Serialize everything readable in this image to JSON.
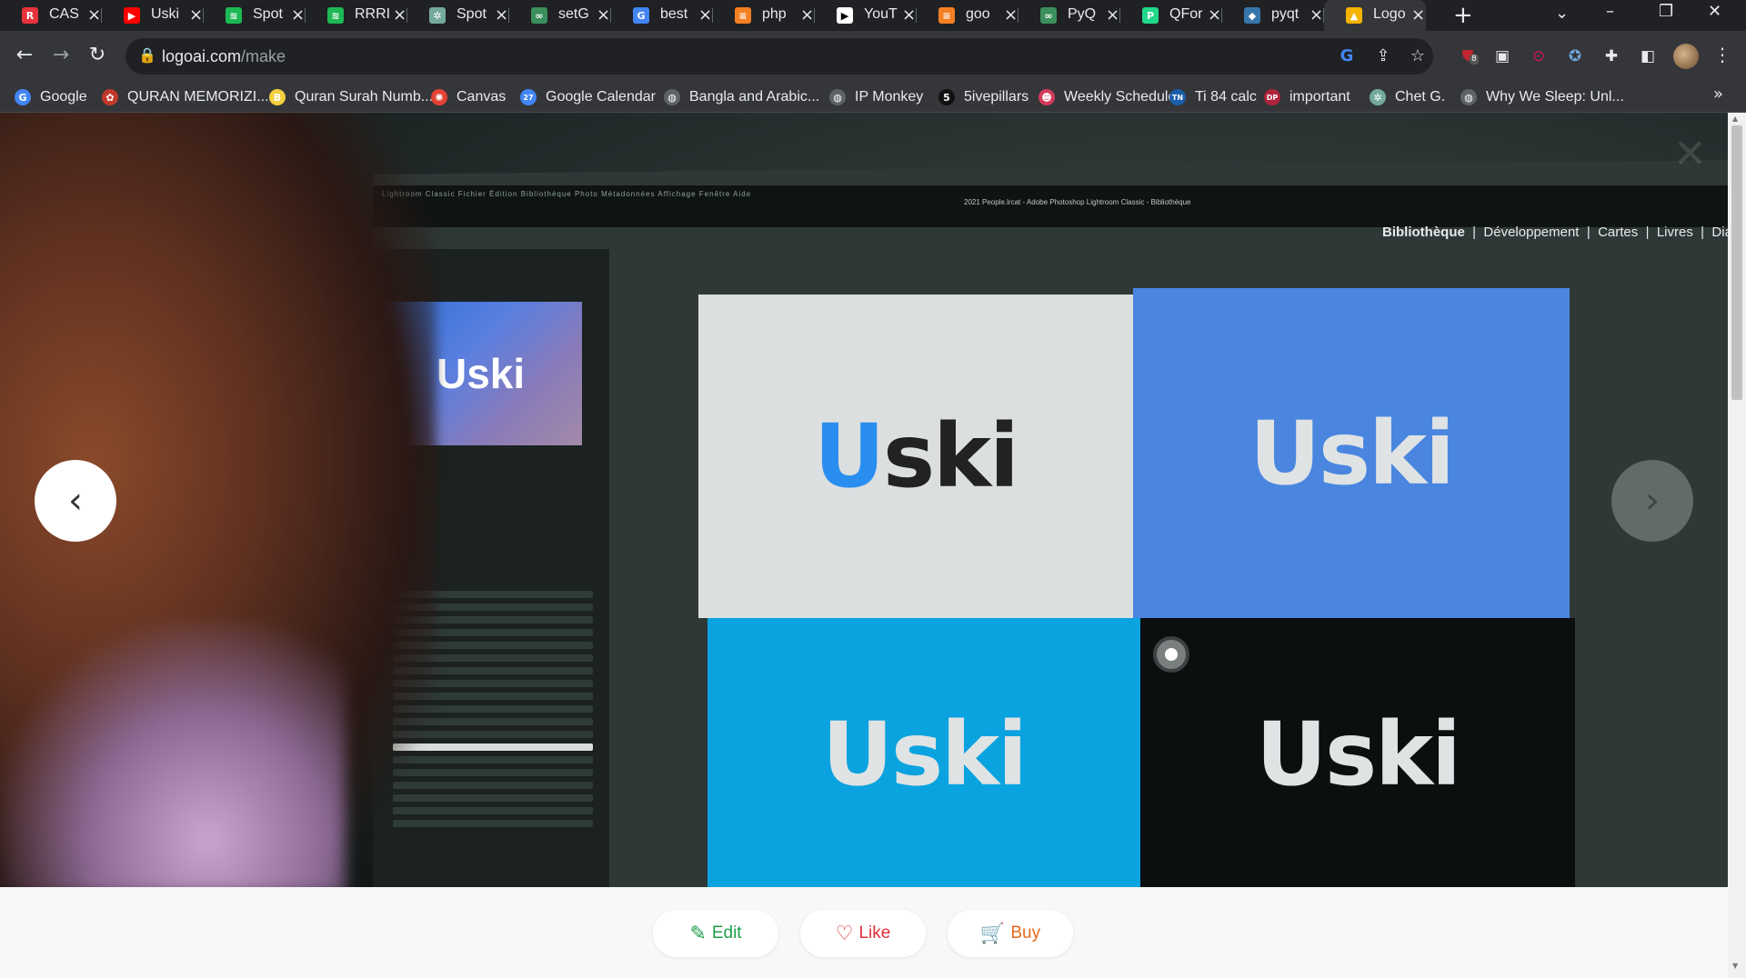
{
  "tabs": [
    {
      "title": "CAS",
      "icon": "cas-icon",
      "color": "#e8333a",
      "glyph": "R"
    },
    {
      "title": "Uski",
      "icon": "youtube-icon",
      "color": "#ff0000",
      "glyph": "▶"
    },
    {
      "title": "Spot",
      "icon": "spotify-icon",
      "color": "#1db954",
      "glyph": "≋"
    },
    {
      "title": "RRRI",
      "icon": "spotify-icon",
      "color": "#1db954",
      "glyph": "≋"
    },
    {
      "title": "Spot",
      "icon": "chatgpt-icon",
      "color": "#74aa9c",
      "glyph": "✲"
    },
    {
      "title": "setG",
      "icon": "link-icon",
      "color": "#3a8f5c",
      "glyph": "∞"
    },
    {
      "title": "best",
      "icon": "google-icon",
      "color": "#4285f4",
      "glyph": "G"
    },
    {
      "title": "php",
      "icon": "stackoverflow-icon",
      "color": "#f48024",
      "glyph": "≡"
    },
    {
      "title": "YouT",
      "icon": "youtube-studio-icon",
      "color": "#ffffff",
      "glyph": "▶"
    },
    {
      "title": "goo",
      "icon": "stackoverflow-icon",
      "color": "#f48024",
      "glyph": "≡"
    },
    {
      "title": "PyQ",
      "icon": "link-icon",
      "color": "#3a8f5c",
      "glyph": "∞"
    },
    {
      "title": "QFor",
      "icon": "pycharm-icon",
      "color": "#21d789",
      "glyph": "P"
    },
    {
      "title": "pyqt",
      "icon": "python-icon",
      "color": "#3776ab",
      "glyph": "◆"
    },
    {
      "title": "Logo",
      "icon": "logoai-icon",
      "color": "#f4b400",
      "glyph": "▲",
      "active": true
    }
  ],
  "toolbar": {
    "url_host": "logoai.com",
    "url_path": "/make"
  },
  "extensions": {
    "ublock_badge": "8"
  },
  "bookmarks": [
    {
      "label": "Google",
      "icon": "google-icon",
      "color": "#4285f4",
      "glyph": "G"
    },
    {
      "label": "QURAN MEMORIZI...",
      "icon": "quran-icon",
      "color": "#c0392b",
      "glyph": "✿"
    },
    {
      "label": "Quran Surah Numb...",
      "icon": "b-icon",
      "color": "#f4d03f",
      "glyph": "B"
    },
    {
      "label": "Canvas",
      "icon": "canvas-icon",
      "color": "#e34234",
      "glyph": "✺"
    },
    {
      "label": "Google Calendar",
      "icon": "calendar-icon",
      "color": "#4285f4",
      "glyph": "27"
    },
    {
      "label": "Bangla and Arabic...",
      "icon": "globe-icon",
      "color": "#5f6368",
      "glyph": "◍"
    },
    {
      "label": "IP Monkey",
      "icon": "globe-icon",
      "color": "#5f6368",
      "glyph": "◍"
    },
    {
      "label": "5ivepillars",
      "icon": "fivepillars-icon",
      "color": "#111111",
      "glyph": "5"
    },
    {
      "label": "Weekly Schedule",
      "icon": "schedule-icon",
      "color": "#d63a5a",
      "glyph": "☻"
    },
    {
      "label": "Ti 84 calc",
      "icon": "ti-icon",
      "color": "#1a5dab",
      "glyph": "TN"
    },
    {
      "label": "important",
      "icon": "dp-icon",
      "color": "#b0233a",
      "glyph": "DP"
    },
    {
      "label": "Chet G.",
      "icon": "chatgpt-icon",
      "color": "#74aa9c",
      "glyph": "✲"
    },
    {
      "label": "Why We Sleep: Unl...",
      "icon": "globe-icon",
      "color": "#5f6368",
      "glyph": "◍"
    }
  ],
  "viewer": {
    "thumb_brand": "Uski",
    "monitor_menu": "Lightroom Classic   Fichier   Édition   Bibliothèque   Photo   Métadonnées   Affichage   Fenêtre   Aide",
    "monitor_title": "2021 People.lrcat - Adobe Photoshop Lightroom Classic - Bibliothèque",
    "modules": [
      "Bibliothèque",
      "Développement",
      "Cartes",
      "Livres",
      "Dia"
    ],
    "logo_u": "U",
    "logo_rest": "ski"
  },
  "actions": {
    "edit": "Edit",
    "like": "Like",
    "buy": "Buy"
  }
}
